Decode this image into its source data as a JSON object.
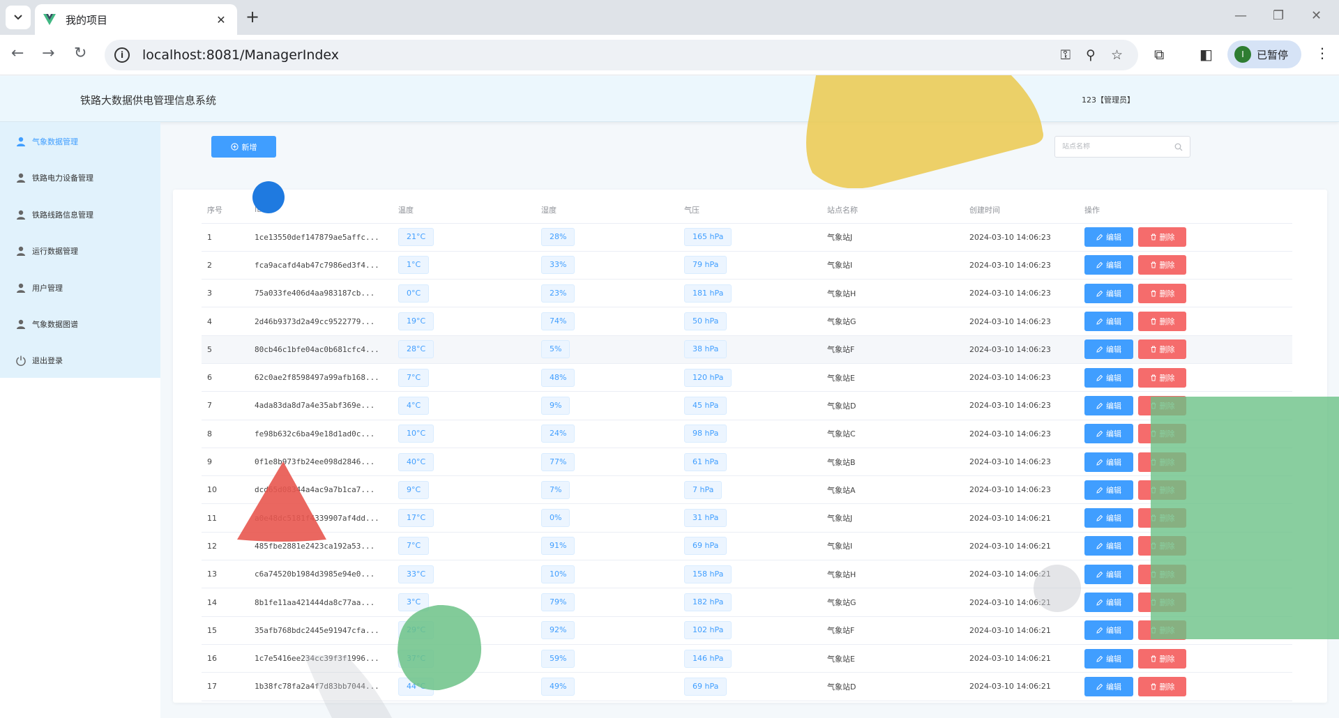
{
  "browser": {
    "tab_title": "我的项目",
    "tab_close": "✕",
    "new_tab": "+",
    "url": "localhost:8081/ManagerIndex",
    "profile_initial": "I",
    "profile_label": "已暂停"
  },
  "app": {
    "title": "铁路大数据供电管理信息系统",
    "user": "123【管理员】"
  },
  "sidebar": {
    "items": [
      {
        "label": "气象数据管理",
        "active": true
      },
      {
        "label": "铁路电力设备管理"
      },
      {
        "label": "铁路线路信息管理"
      },
      {
        "label": "运行数据管理"
      },
      {
        "label": "用户管理"
      },
      {
        "label": "气象数据图谱"
      },
      {
        "label": "退出登录"
      }
    ]
  },
  "toolbar": {
    "add_label": "新增",
    "search_placeholder": "站点名称"
  },
  "table": {
    "headers": [
      "序号",
      "ID",
      "温度",
      "湿度",
      "气压",
      "站点名称",
      "创建时间",
      "操作"
    ],
    "edit_label": "编辑",
    "delete_label": "删除",
    "rows": [
      {
        "no": "1",
        "id": "1ce13550def147879ae5affc...",
        "temp": "21°C",
        "hum": "28%",
        "press": "165 hPa",
        "station": "气象站J",
        "time": "2024-03-10 14:06:23"
      },
      {
        "no": "2",
        "id": "fca9acafd4ab47c7986ed3f4...",
        "temp": "1°C",
        "hum": "33%",
        "press": "79 hPa",
        "station": "气象站I",
        "time": "2024-03-10 14:06:23"
      },
      {
        "no": "3",
        "id": "75a033fe406d4aa983187cb...",
        "temp": "0°C",
        "hum": "23%",
        "press": "181 hPa",
        "station": "气象站H",
        "time": "2024-03-10 14:06:23"
      },
      {
        "no": "4",
        "id": "2d46b9373d2a49cc9522779...",
        "temp": "19°C",
        "hum": "74%",
        "press": "50 hPa",
        "station": "气象站G",
        "time": "2024-03-10 14:06:23"
      },
      {
        "no": "5",
        "id": "80cb46c1bfe04ac0b681cfc4...",
        "temp": "28°C",
        "hum": "5%",
        "press": "38 hPa",
        "station": "气象站F",
        "time": "2024-03-10 14:06:23"
      },
      {
        "no": "6",
        "id": "62c0ae2f8598497a99afb168...",
        "temp": "7°C",
        "hum": "48%",
        "press": "120 hPa",
        "station": "气象站E",
        "time": "2024-03-10 14:06:23"
      },
      {
        "no": "7",
        "id": "4ada83da8d7a4e35abf369e...",
        "temp": "4°C",
        "hum": "9%",
        "press": "45 hPa",
        "station": "气象站D",
        "time": "2024-03-10 14:06:23"
      },
      {
        "no": "8",
        "id": "fe98b632c6ba49e18d1ad0c...",
        "temp": "10°C",
        "hum": "24%",
        "press": "98 hPa",
        "station": "气象站C",
        "time": "2024-03-10 14:06:23"
      },
      {
        "no": "9",
        "id": "0f1e8b973fb24ee098d2846...",
        "temp": "40°C",
        "hum": "77%",
        "press": "61 hPa",
        "station": "气象站B",
        "time": "2024-03-10 14:06:23"
      },
      {
        "no": "10",
        "id": "dcd65d08344a4ac9a7b1ca7...",
        "temp": "9°C",
        "hum": "7%",
        "press": "7 hPa",
        "station": "气象站A",
        "time": "2024-03-10 14:06:23"
      },
      {
        "no": "11",
        "id": "a0e48dc5181f4339907af4dd...",
        "temp": "17°C",
        "hum": "0%",
        "press": "31 hPa",
        "station": "气象站J",
        "time": "2024-03-10 14:06:21"
      },
      {
        "no": "12",
        "id": "485fbe2881e2423ca192a53...",
        "temp": "7°C",
        "hum": "91%",
        "press": "69 hPa",
        "station": "气象站I",
        "time": "2024-03-10 14:06:21"
      },
      {
        "no": "13",
        "id": "c6a74520b1984d3985e94e0...",
        "temp": "33°C",
        "hum": "10%",
        "press": "158 hPa",
        "station": "气象站H",
        "time": "2024-03-10 14:06:21"
      },
      {
        "no": "14",
        "id": "8b1fe11aa421444da8c77aa...",
        "temp": "3°C",
        "hum": "79%",
        "press": "182 hPa",
        "station": "气象站G",
        "time": "2024-03-10 14:06:21"
      },
      {
        "no": "15",
        "id": "35afb768bdc2445e91947cfa...",
        "temp": "29°C",
        "hum": "92%",
        "press": "102 hPa",
        "station": "气象站F",
        "time": "2024-03-10 14:06:21"
      },
      {
        "no": "16",
        "id": "1c7e5416ee234cc39f3f1996...",
        "temp": "37°C",
        "hum": "59%",
        "press": "146 hPa",
        "station": "气象站E",
        "time": "2024-03-10 14:06:21"
      },
      {
        "no": "17",
        "id": "1b38fc78fa2a4f7d83bb7044...",
        "temp": "44°C",
        "hum": "49%",
        "press": "69 hPa",
        "station": "气象站D",
        "time": "2024-03-10 14:06:21"
      }
    ]
  },
  "colors": {
    "primary": "#409eff",
    "danger": "#f56c6c",
    "sidebar_bg": "#e1f2fc",
    "header_bg": "#ecf7fd"
  }
}
